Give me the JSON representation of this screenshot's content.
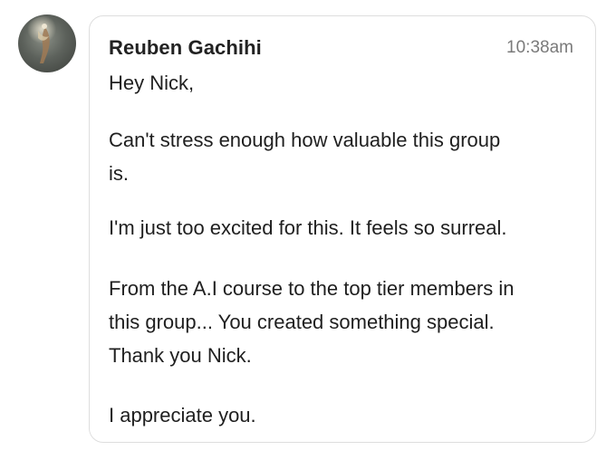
{
  "message": {
    "sender_name": "Reuben Gachihi",
    "timestamp": "10:38am",
    "avatar_icon": "user-avatar-photo",
    "lines": {
      "greeting": "Hey Nick,",
      "p1_l1": "Can't stress enough how valuable this group",
      "p1_l2": "is.",
      "p2_l1": "I'm just too excited for this. It feels so surreal.",
      "p3_l1": "From the A.I course to the top tier members in",
      "p3_l2": "this group... You created something special.",
      "p3_l3": "Thank you Nick.",
      "p4_l1": "I appreciate you."
    }
  },
  "colors": {
    "text": "#1f1f1f",
    "timestamp": "#7a7a7a",
    "bubble_border": "#dedede",
    "background": "#ffffff"
  }
}
